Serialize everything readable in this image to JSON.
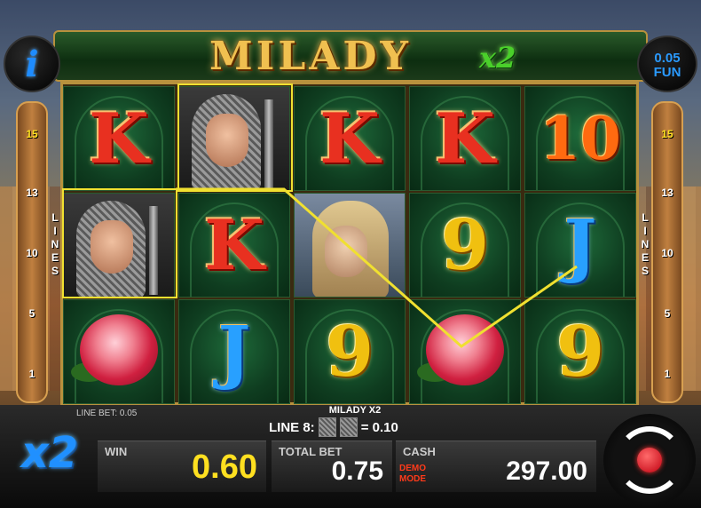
{
  "title": "MILADY",
  "title_multiplier": "x2",
  "fun_label": "0.05\nFUN",
  "info_icon": "i",
  "lines_word": [
    "L",
    "I",
    "N",
    "E",
    "S"
  ],
  "left_lines": [
    "15",
    "13",
    "10",
    "5",
    "1"
  ],
  "right_lines": [
    "15",
    "13",
    "10",
    "5",
    "1"
  ],
  "active_line": "15",
  "reels": [
    [
      "K",
      "knight",
      "rose"
    ],
    [
      "knight",
      "K",
      "J"
    ],
    [
      "K",
      "lady",
      "9"
    ],
    [
      "K",
      "9",
      "rose"
    ],
    [
      "10",
      "J",
      "9"
    ]
  ],
  "bottom": {
    "line_bet": "LINE BET: 0.05",
    "game_name": "MILADY X2",
    "line_win_label": "LINE 8:",
    "line_win_value": "= 0.10",
    "multiplier_badge": "x2",
    "win_label": "WIN",
    "win_value": "0.60",
    "total_bet_label": "TOTAL BET",
    "total_bet_value": "0.75",
    "cash_label": "CASH",
    "cash_value": "297.00",
    "demo_mode": "DEMO\nMODE"
  },
  "colors": {
    "payline": "#f0e030",
    "win_value": "#ffe020",
    "demo": "#ff3a1a",
    "accent_blue": "#2090ff"
  }
}
